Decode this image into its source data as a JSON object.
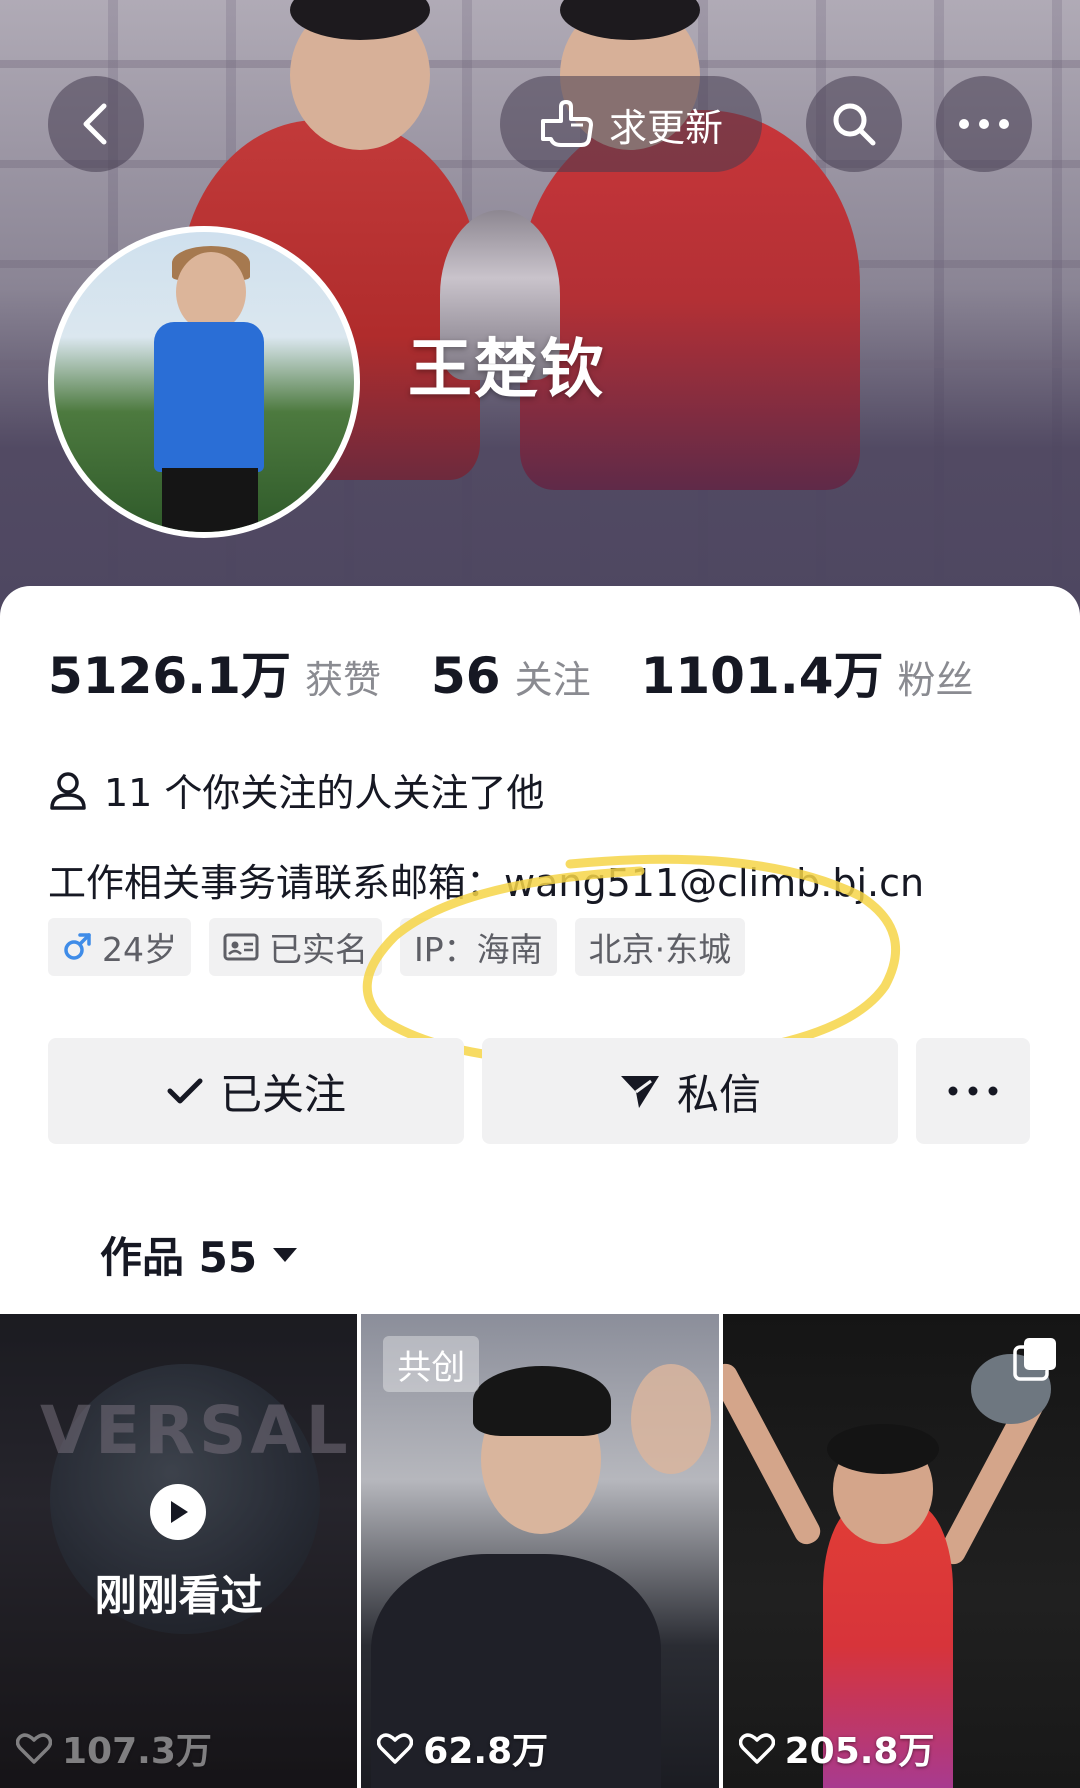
{
  "header": {
    "update_label": "求更新",
    "nickname": "王楚钦"
  },
  "stats": [
    {
      "value": "5126.1万",
      "label": "获赞"
    },
    {
      "value": "56",
      "label": "关注"
    },
    {
      "value": "1101.4万",
      "label": "粉丝"
    }
  ],
  "mutual": "11 个你关注的人关注了他",
  "bio": "工作相关事务请联系邮箱：wang511@climb.bj.cn",
  "tags": {
    "age": "24岁",
    "verified": "已实名",
    "ip": "IP：海南",
    "location": "北京·东城"
  },
  "actions": {
    "follow": "已关注",
    "message": "私信"
  },
  "works": {
    "label": "作品 55"
  },
  "videos": [
    {
      "overlay": "刚刚看过",
      "likes": "107.3万",
      "bg_text": "VERSAL"
    },
    {
      "badge": "共创",
      "likes": "62.8万"
    },
    {
      "likes": "205.8万"
    }
  ],
  "colors": {
    "annotation": "#f6d548",
    "text_primary": "#161823",
    "text_secondary": "#8a8b91",
    "tag_bg": "#f1f1f2",
    "gender": "#3f8ce8"
  }
}
